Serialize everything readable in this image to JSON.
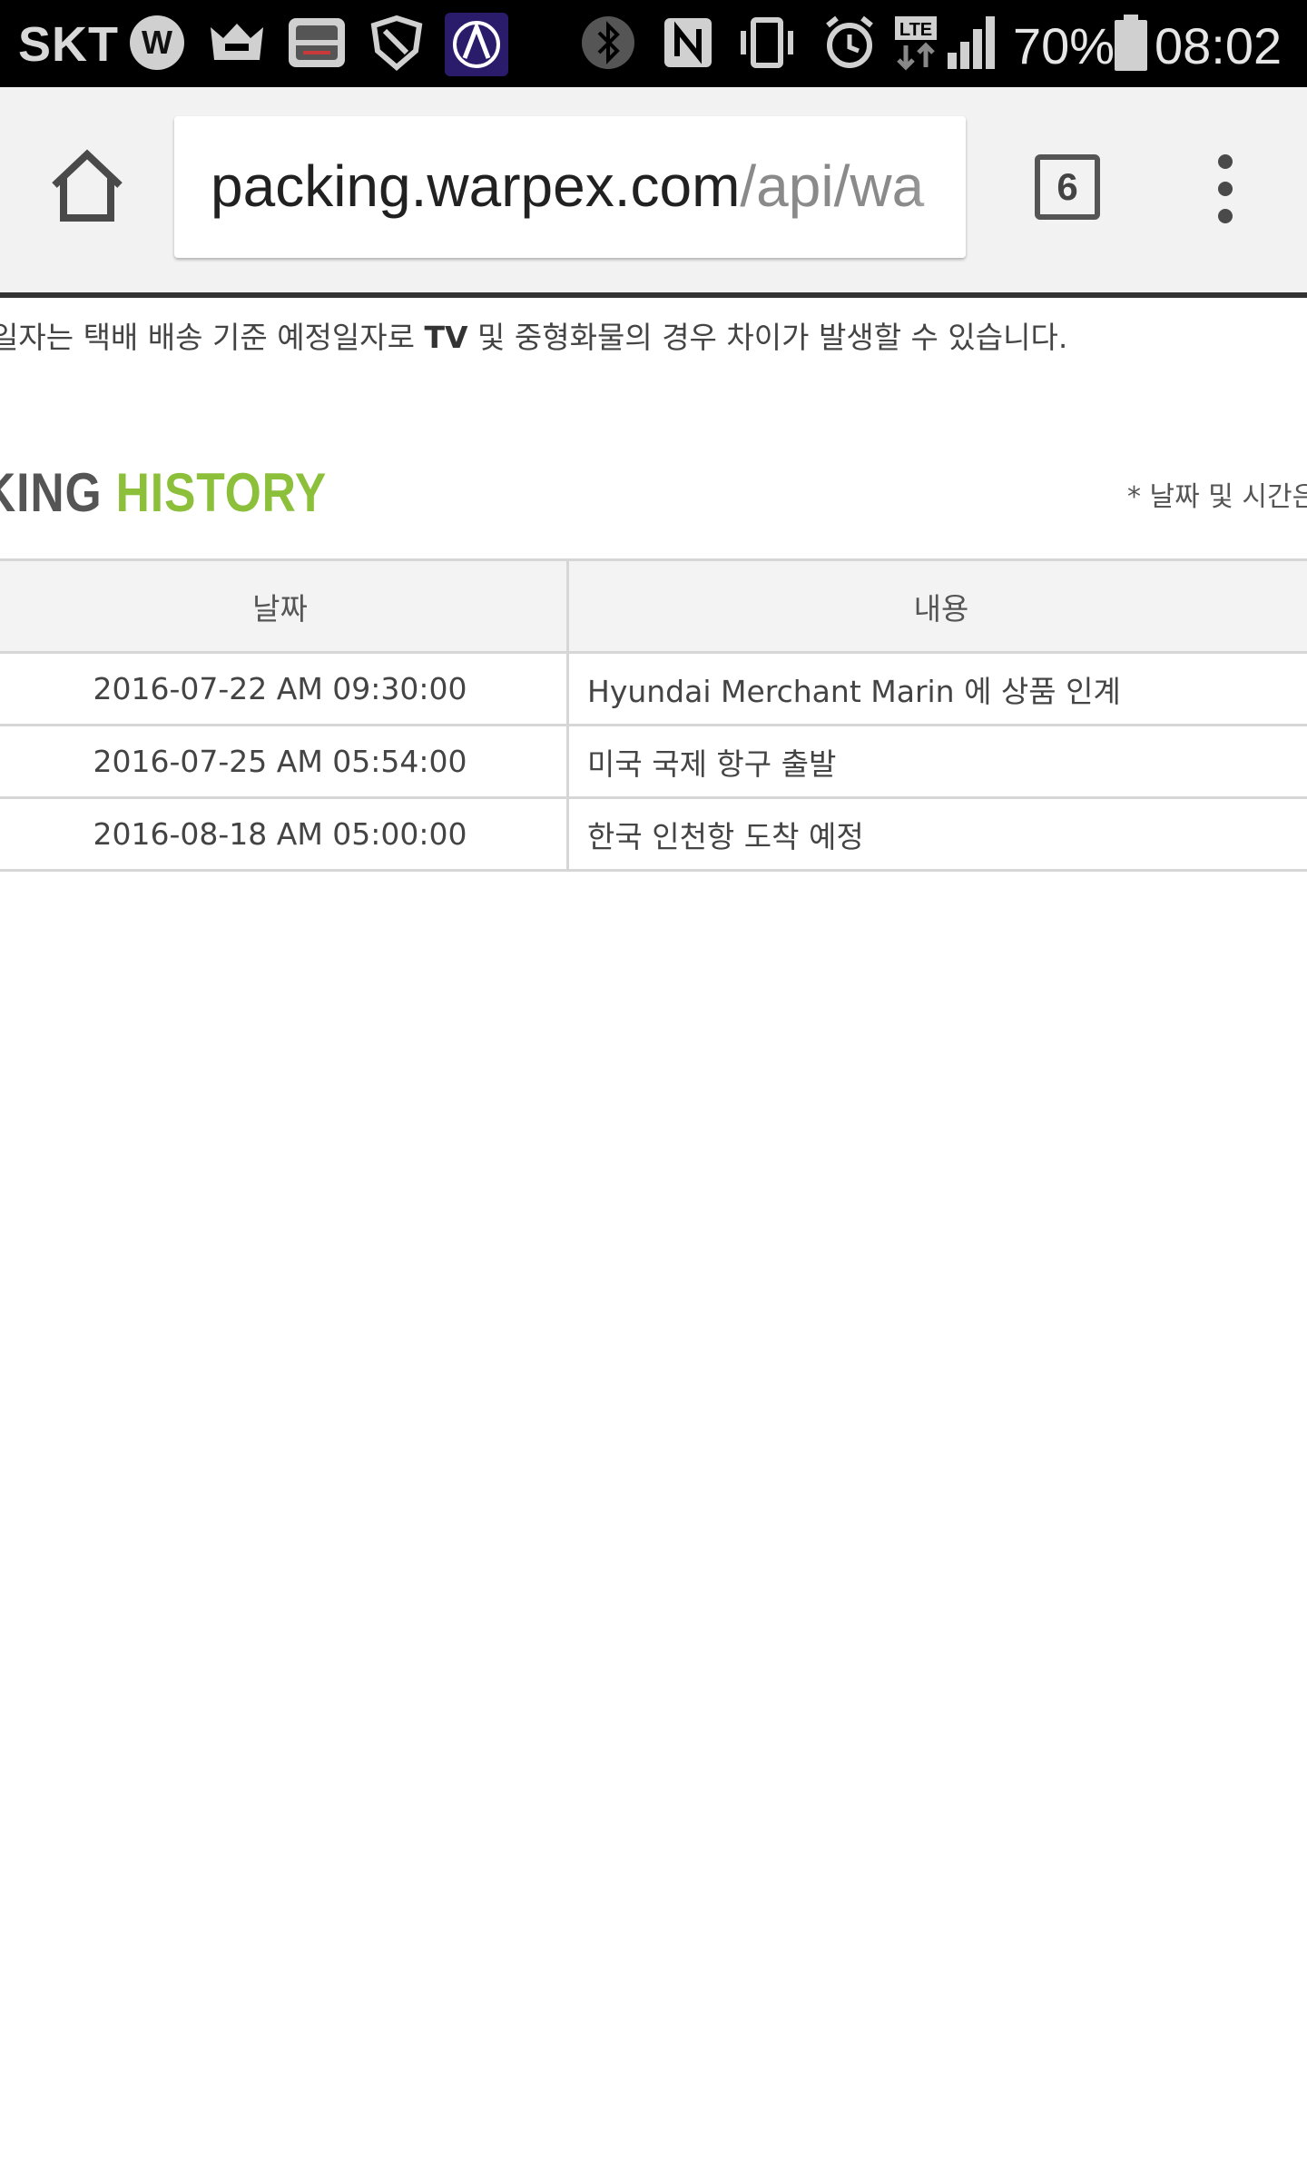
{
  "status_bar": {
    "carrier": "SKT",
    "battery_percent": "70%",
    "time": "08:02",
    "icons": [
      "whatsapp-w-icon",
      "app-crown-icon",
      "app-box-icon",
      "shield-app-icon",
      "arc-app-icon",
      "bluetooth-icon",
      "nfc-icon",
      "vibrate-icon",
      "alarm-icon",
      "lte-icon",
      "signal-icon",
      "battery-icon"
    ]
  },
  "browser": {
    "url_host": "packing.warpex.com",
    "url_path": "/api/wa",
    "tab_count": "6",
    "icons": [
      "home-icon",
      "overflow-menu-icon"
    ]
  },
  "page": {
    "notice_part1": "일자는 택배 배송 기준 예정일자로 ",
    "notice_bold": "TV",
    "notice_part2": " 및 중형화물의 경우 차이가 발생할 수 있습니다.",
    "title_part1": "KING ",
    "title_part2": "HISTORY",
    "title_note": "* 날짜 및 시간은",
    "colors": {
      "title_green": "#8cbf3a",
      "title_gray": "#555555"
    },
    "table": {
      "headers": {
        "date": "날짜",
        "description": "내용"
      },
      "rows": [
        {
          "date": "2016-07-22 AM 09:30:00",
          "description": "Hyundai Merchant Marin 에 상품 인계"
        },
        {
          "date": "2016-07-25 AM 05:54:00",
          "description": "미국 국제 항구 출발"
        },
        {
          "date": "2016-08-18 AM 05:00:00",
          "description": "한국 인천항 도착 예정"
        }
      ]
    }
  }
}
